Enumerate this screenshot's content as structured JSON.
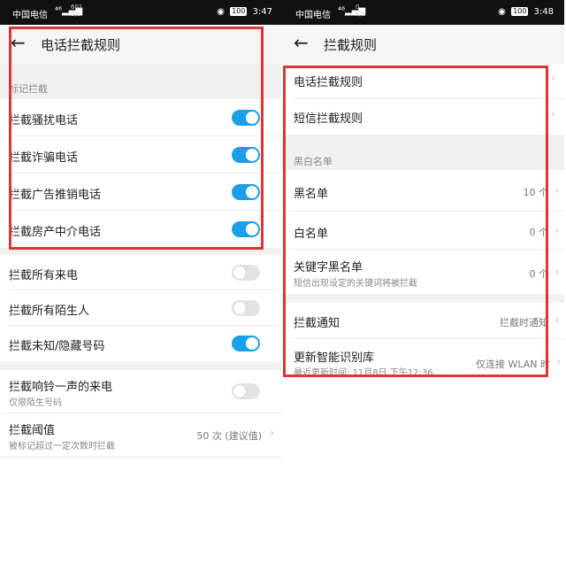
{
  "left": {
    "status": {
      "carrier": "中国电信",
      "speed_top": "601",
      "speed_bottom": "B/s",
      "battery": "100",
      "time": "3:47"
    },
    "title": "电话拦截规则",
    "section_label": "标记拦截",
    "marked_items": [
      {
        "label": "拦截骚扰电话",
        "on": true
      },
      {
        "label": "拦截诈骗电话",
        "on": true
      },
      {
        "label": "拦截广告推销电话",
        "on": true
      },
      {
        "label": "拦截房产中介电话",
        "on": true
      }
    ],
    "other_items": [
      {
        "label": "拦截所有来电",
        "on": false
      },
      {
        "label": "拦截所有陌生人",
        "on": false
      },
      {
        "label": "拦截未知/隐藏号码",
        "on": true
      }
    ],
    "ring_item": {
      "label": "拦截响铃一声的来电",
      "sub": "仅限陌生号码",
      "on": false
    },
    "threshold": {
      "label": "拦截阈值",
      "sub": "被标记超过一定次数时拦截",
      "value": "50 次 (建议值)"
    }
  },
  "right": {
    "status": {
      "carrier": "中国电信",
      "speed_top": "0",
      "speed_bottom": "K/s",
      "battery": "100",
      "time": "3:48"
    },
    "title": "拦截规则",
    "rules": [
      {
        "label": "电话拦截规则"
      },
      {
        "label": "短信拦截规则"
      }
    ],
    "section_label": "黑白名单",
    "lists": [
      {
        "label": "黑名单",
        "value": "10 个"
      },
      {
        "label": "白名单",
        "value": "0 个"
      },
      {
        "label": "关键字黑名单",
        "sub": "短信出现设定的关键词将被拦截",
        "value": "0 个"
      }
    ],
    "notify": {
      "label": "拦截通知",
      "value": "拦截时通知"
    },
    "update": {
      "label": "更新智能识别库",
      "sub": "最近更新时间: 11月8日 下午12:36",
      "value": "仅连接 WLAN 时"
    }
  }
}
